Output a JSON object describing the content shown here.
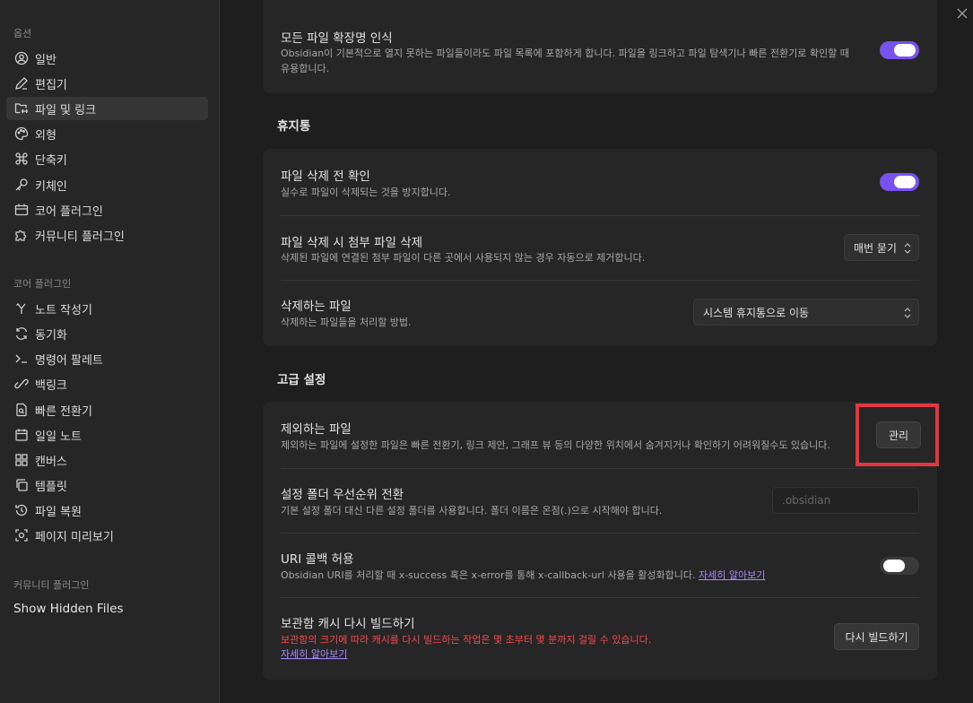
{
  "sidebar": {
    "options_header": "옵션",
    "options": [
      {
        "label": "일반",
        "icon": "user-circle-icon"
      },
      {
        "label": "편집기",
        "icon": "pencil-icon"
      },
      {
        "label": "파일 및 링크",
        "icon": "folder-link-icon",
        "active": true
      },
      {
        "label": "외형",
        "icon": "palette-icon"
      },
      {
        "label": "단축키",
        "icon": "command-icon"
      },
      {
        "label": "키체인",
        "icon": "key-icon"
      },
      {
        "label": "코어 플러그인",
        "icon": "calendar-box-icon"
      },
      {
        "label": "커뮤니티 플러그인",
        "icon": "puzzle-icon"
      }
    ],
    "core_header": "코어 플러그인",
    "core": [
      {
        "label": "노트 작성기",
        "icon": "merge-icon"
      },
      {
        "label": "동기화",
        "icon": "sync-icon"
      },
      {
        "label": "명령어 팔레트",
        "icon": "terminal-icon"
      },
      {
        "label": "백링크",
        "icon": "link-icon"
      },
      {
        "label": "빠른 전환기",
        "icon": "file-search-icon"
      },
      {
        "label": "일일 노트",
        "icon": "calendar-icon"
      },
      {
        "label": "캔버스",
        "icon": "grid-icon"
      },
      {
        "label": "템플릿",
        "icon": "copy-icon"
      },
      {
        "label": "파일 복원",
        "icon": "history-icon"
      },
      {
        "label": "페이지 미리보기",
        "icon": "preview-icon"
      }
    ],
    "community_header": "커뮤니티 플러그인",
    "community": [
      {
        "label": "Show Hidden Files"
      }
    ]
  },
  "main": {
    "detect_ext": {
      "title": "모든 파일 확장명 인식",
      "desc1": "Obsidian이 기본적으로 열지 못하는 파일들이라도 파일 목록에 포함하게 합니다. 파일을 링크하고 파일 탐색기나 빠른 전환기로 확인할 때",
      "desc2": "유용합니다.",
      "toggle": "on"
    },
    "trash_header": "휴지통",
    "confirm_delete": {
      "title": "파일 삭제 전 확인",
      "desc": "실수로 파일이 삭제되는 것을 방지합니다.",
      "toggle": "on"
    },
    "delete_attachments": {
      "title": "파일 삭제 시 첨부 파일 삭제",
      "desc": "삭제된 파일에 연결된 첨부 파일이 다른 곳에서 사용되지 않는 경우 자동으로 제거합니다.",
      "value": "매번 묻기"
    },
    "deleted_files": {
      "title": "삭제하는 파일",
      "desc": "삭제하는 파일들을 처리할 방법.",
      "value": "시스템 휴지통으로 이동"
    },
    "advanced_header": "고급 설정",
    "excluded": {
      "title": "제외하는 파일",
      "desc": "제외하는 파일에 설정한 파일은 빠른 전환기, 링크 제안, 그래프 뷰 등의 다양한 위치에서 숨겨지거나 확인하기 어려워질수도 있습니다.",
      "button": "관리"
    },
    "config_folder": {
      "title": "설정 폴더 우선순위 전환",
      "desc": "기본 설정 폴더 대신 다른 설정 폴더를 사용합니다. 폴더 이름은 온점(.)으로 시작해야 합니다.",
      "placeholder": ".obsidian"
    },
    "uri": {
      "title": "URI 콜백 허용",
      "desc": "Obsidian URI를 처리할 때 x-success 혹은 x-error를 통해 x-callback-url 사용을 활성화합니다.",
      "link": "자세히 알아보기",
      "toggle": "off"
    },
    "rebuild": {
      "title": "보관함 캐시 다시 빌드하기",
      "desc": "보관함의 크기에 따라 캐시를 다시 빌드하는 작업은 몇 초부터 몇 분까지 걸릴 수 있습니다.",
      "link": "자세히 알아보기",
      "button": "다시 빌드하기"
    }
  },
  "colors": {
    "accent": "#7852ee",
    "warning": "#fb464c",
    "highlight": "#e5353f",
    "link": "#a68af9"
  }
}
